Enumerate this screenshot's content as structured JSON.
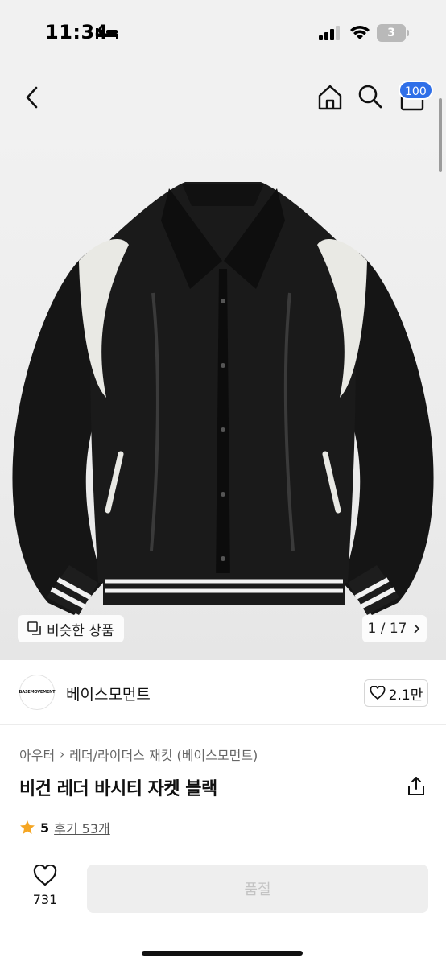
{
  "status_bar": {
    "time": "11:34",
    "battery": "3",
    "icons": [
      "bed-icon",
      "signal-icon",
      "wifi-icon",
      "battery-icon"
    ]
  },
  "nav": {
    "icons": [
      "back-icon",
      "home-icon",
      "search-icon",
      "cart-icon"
    ],
    "cart_badge": "100"
  },
  "gallery": {
    "similar_label": "비슷한 상품",
    "counter": "1 / 17",
    "icons": [
      "similar-products-icon",
      "chevron-right-icon"
    ]
  },
  "brand": {
    "logo_text": "BASEMOVEMENT",
    "name": "베이스모먼트",
    "likes": "2.1만"
  },
  "product": {
    "breadcrumb": [
      "아우터",
      "레더/라이더스 재킷 (베이스모먼트)"
    ],
    "title": "비건 레더 바시티 자켓 블랙",
    "rating": "5",
    "reviews": "후기 53개"
  },
  "bottom_bar": {
    "wish_count": "731",
    "cta_label": "품절"
  },
  "colors": {
    "badge": "#2f6fe8",
    "star": "#f5a623",
    "soldout_bg": "#eeeeee",
    "soldout_text": "#c3c3c3"
  }
}
